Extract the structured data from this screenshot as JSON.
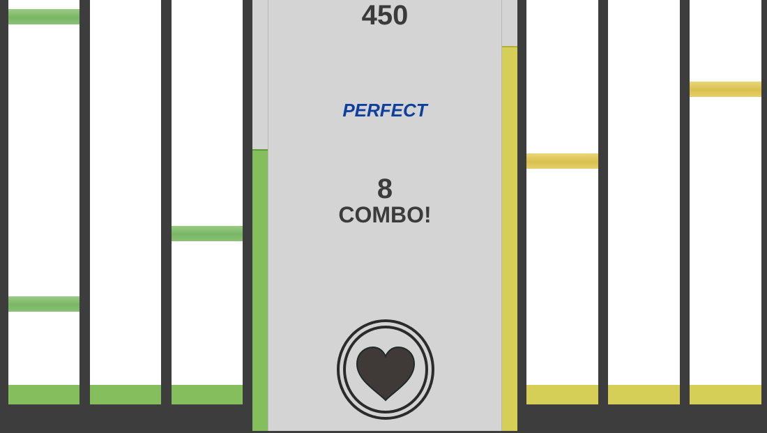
{
  "hud": {
    "score": "450",
    "judgement": "PERFECT",
    "combo_count": "8",
    "combo_label": "COMBO!"
  },
  "colors": {
    "background": "#3d3d3d",
    "lane": "#ffffff",
    "center_panel": "#d4d4d4",
    "green": "#85bf5d",
    "yellow": "#d5cf58",
    "judgement_text": "#0d3f9e",
    "heart": "#3f3a38"
  },
  "meters": {
    "left_level": 0.65,
    "right_level": 0.89
  },
  "center_button": {
    "icon": "heart-icon"
  },
  "lanes": [
    {
      "side": "left",
      "color": "green"
    },
    {
      "side": "left",
      "color": "green"
    },
    {
      "side": "left",
      "color": "green"
    },
    {
      "side": "right",
      "color": "yellow"
    },
    {
      "side": "right",
      "color": "yellow"
    },
    {
      "side": "right",
      "color": "yellow"
    }
  ]
}
